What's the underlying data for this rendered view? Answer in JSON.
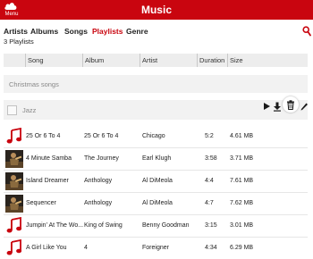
{
  "app": {
    "title": "Music",
    "menu_label": "Menu"
  },
  "tabs": [
    "Artists",
    "Albums",
    "Songs",
    "Playlists",
    "Genre"
  ],
  "active_tab": "Playlists",
  "playlist_count": "3 Playlists",
  "columns": {
    "song": "Song",
    "album": "Album",
    "artist": "Artist",
    "duration": "Duration",
    "size": "Size"
  },
  "playlists": [
    "Christmas songs",
    "Jazz"
  ],
  "songs": [
    {
      "song": "25 Or 6 To 4",
      "album": "25 Or 6 To 4",
      "artist": "Chicago",
      "duration": "5:2",
      "size": "4.61 MB",
      "thumb": "music-note"
    },
    {
      "song": "4 Minute Samba",
      "album": "The Journey",
      "artist": "Earl Klugh",
      "duration": "3:58",
      "size": "3.71 MB",
      "thumb": "album-art"
    },
    {
      "song": "Island Dreamer",
      "album": "Anthology",
      "artist": "Al DiMeola",
      "duration": "4:4",
      "size": "7.61 MB",
      "thumb": "album-art"
    },
    {
      "song": "Sequencer",
      "album": "Anthology",
      "artist": "Al DiMeola",
      "duration": "4:7",
      "size": "7.62 MB",
      "thumb": "album-art"
    },
    {
      "song": "Jumpin' At The Wo...",
      "album": "King of Swing",
      "artist": "Benny Goodman",
      "duration": "3:15",
      "size": "3.01 MB",
      "thumb": "music-note"
    },
    {
      "song": "A Girl Like You",
      "album": "4",
      "artist": "Foreigner",
      "duration": "4:34",
      "size": "6.29 MB",
      "thumb": "music-note"
    }
  ],
  "colors": {
    "brand": "#c9050f",
    "active_tab": "#c9050f",
    "header_bg": "#ededed",
    "row_bg": "#f2f2f2"
  },
  "icons": {
    "menu": "cloud-icon",
    "search": "search-icon",
    "play": "play-icon",
    "download": "download-icon",
    "delete": "trash-icon",
    "edit": "pencil-icon",
    "song_thumb": "music-note-icon"
  }
}
